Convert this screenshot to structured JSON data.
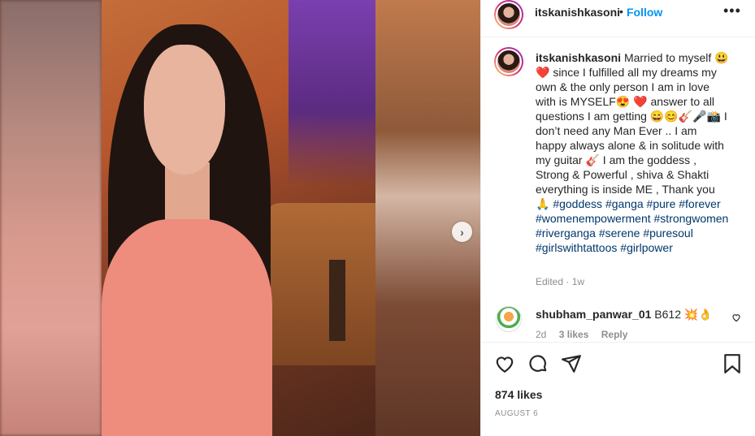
{
  "post": {
    "username": "itskanishkasoni",
    "follow_label": "Follow",
    "more_label": "•••",
    "separator": "•"
  },
  "caption": {
    "username": "itskanishkasoni",
    "text_parts": [
      "Married to myself 😃❤️ since I fulfilled all my dreams my own & the only person I am in love with is MYSELF😍 ❤️ answer to all questions I am getting 😄😊🎸🎤📸 I don’t need any Man Ever .. I am happy always alone & in solitude with my guitar 🎸 I am the goddess , Strong & Powerful , shiva & Shakti everything is inside ME , Thank you 🙏 "
    ],
    "hashtags": [
      "#goddess",
      "#ganga",
      "#pure",
      "#forever",
      "#womenempowerment",
      "#strongwomen",
      "#riverganga",
      "#serene",
      "#puresoul",
      "#girlswithtattoos",
      "#girlpower"
    ],
    "edited": "Edited",
    "time": "1w"
  },
  "comment": {
    "username": "shubham_panwar_01",
    "text": "B612 💥👌",
    "time": "2d",
    "likes": "3 likes",
    "reply": "Reply"
  },
  "actions": {
    "icons": [
      "heart-icon",
      "comment-icon",
      "share-icon",
      "save-icon"
    ],
    "likes": "874 likes",
    "date": "AUGUST 6"
  },
  "media": {
    "next_label": "›"
  }
}
